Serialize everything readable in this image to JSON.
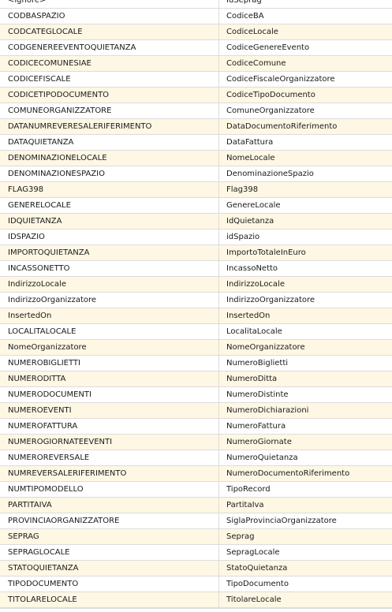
{
  "mappings": [
    {
      "source": "<ignore>",
      "target": "IdSeprag"
    },
    {
      "source": "CODBASPAZIO",
      "target": "CodiceBA"
    },
    {
      "source": "CODCATEGLOCALE",
      "target": "CodiceLocale"
    },
    {
      "source": "CODGENEREEVENTOQUIETANZA",
      "target": "CodiceGenereEvento"
    },
    {
      "source": "CODICECOMUNESIAE",
      "target": "CodiceComune"
    },
    {
      "source": "CODICEFISCALE",
      "target": "CodiceFiscaleOrganizzatore"
    },
    {
      "source": "CODICETIPODOCUMENTO",
      "target": "CodiceTipoDocumento"
    },
    {
      "source": "COMUNEORGANIZZATORE",
      "target": "ComuneOrganizzatore"
    },
    {
      "source": "DATANUMREVERESALERIFERIMENTO",
      "target": "DataDocumentoRiferimento"
    },
    {
      "source": "DATAQUIETANZA",
      "target": "DataFattura"
    },
    {
      "source": "DENOMINAZIONELOCALE",
      "target": "NomeLocale"
    },
    {
      "source": "DENOMINAZIONESPAZIO",
      "target": "DenominazioneSpazio"
    },
    {
      "source": "FLAG398",
      "target": "Flag398"
    },
    {
      "source": "GENERELOCALE",
      "target": "GenereLocale"
    },
    {
      "source": "IDQUIETANZA",
      "target": "IdQuietanza"
    },
    {
      "source": "IDSPAZIO",
      "target": "idSpazio"
    },
    {
      "source": "IMPORTOQUIETANZA",
      "target": "ImportoTotaleInEuro"
    },
    {
      "source": "INCASSONETTO",
      "target": "IncassoNetto"
    },
    {
      "source": "IndirizzoLocale",
      "target": "IndirizzoLocale"
    },
    {
      "source": "IndirizzoOrganizzatore",
      "target": "IndirizzoOrganizzatore"
    },
    {
      "source": "InsertedOn",
      "target": "InsertedOn"
    },
    {
      "source": "LOCALITALOCALE",
      "target": "LocalitaLocale"
    },
    {
      "source": "NomeOrganizzatore",
      "target": "NomeOrganizzatore"
    },
    {
      "source": "NUMEROBIGLIETTI",
      "target": "NumeroBiglietti"
    },
    {
      "source": "NUMERODITTA",
      "target": "NumeroDitta"
    },
    {
      "source": "NUMERODOCUMENTI",
      "target": "NumeroDistinte"
    },
    {
      "source": "NUMEROEVENTI",
      "target": "NumeroDichiarazioni"
    },
    {
      "source": "NUMEROFATTURA",
      "target": "NumeroFattura"
    },
    {
      "source": "NUMEROGIORNATEEVENTI",
      "target": "NumeroGiornate"
    },
    {
      "source": "NUMEROREVERSALE",
      "target": "NumeroQuietanza"
    },
    {
      "source": "NUMREVERSALERIFERIMENTO",
      "target": "NumeroDocumentoRiferimento"
    },
    {
      "source": "NUMTIPOMODELLO",
      "target": "TipoRecord"
    },
    {
      "source": "PARTITAIVA",
      "target": "PartitaIva"
    },
    {
      "source": "PROVINCIAORGANIZZATORE",
      "target": "SiglaProvinciaOrganizzatore"
    },
    {
      "source": "SEPRAG",
      "target": "Seprag"
    },
    {
      "source": "SEPRAGLOCALE",
      "target": "SepragLocale"
    },
    {
      "source": "STATOQUIETANZA",
      "target": "StatoQuietanza"
    },
    {
      "source": "TIPODOCUMENTO",
      "target": "TipoDocumento"
    },
    {
      "source": "TITOLARELOCALE",
      "target": "TitolareLocale"
    }
  ],
  "colors": {
    "row_alt": "#fdf7e4",
    "row_plain": "#ffffff",
    "grid_line": "#dcdcdc"
  }
}
